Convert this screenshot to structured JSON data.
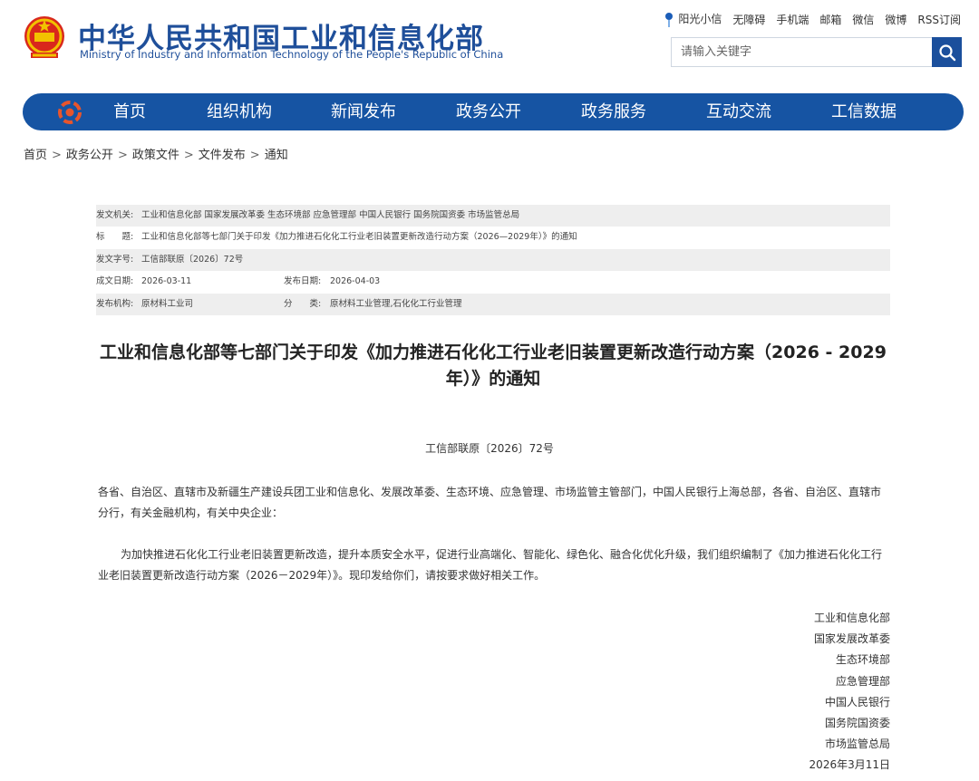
{
  "header": {
    "title": "中华人民共和国工业和信息化部",
    "subtitle": "Ministry of Industry and Information Technology of the People's Republic of China",
    "emblem_icon": "national-emblem-icon"
  },
  "toplinks": [
    "阳光小信",
    "无障碍",
    "手机端",
    "邮箱",
    "微信",
    "微博",
    "RSS订阅"
  ],
  "search": {
    "placeholder": "请输入关键字",
    "value": "",
    "icon": "search-icon"
  },
  "nav": {
    "logo_icon": "miit-logo-icon",
    "items": [
      "首页",
      "组织机构",
      "新闻发布",
      "政务公开",
      "政务服务",
      "互动交流",
      "工信数据"
    ]
  },
  "breadcrumb": [
    "首页",
    "政务公开",
    "政策文件",
    "文件发布",
    "通知"
  ],
  "meta": {
    "issuer_label": "发文机关:",
    "issuer": "工业和信息化部 国家发展改革委 生态环境部 应急管理部 中国人民银行 国务院国资委 市场监管总局",
    "title_label": "标　　题:",
    "title": "工业和信息化部等七部门关于印发《加力推进石化化工行业老旧装置更新改造行动方案（2026—2029年）》的通知",
    "docno_label": "发文字号:",
    "docno": "工信部联原〔2026〕72号",
    "created_label": "成文日期:",
    "created": "2026-03-11",
    "published_label": "发布日期:",
    "published": "2026-04-03",
    "org_label": "发布机构:",
    "org": "原材料工业司",
    "category_label": "分　　类:",
    "category": "原材料工业管理,石化化工行业管理"
  },
  "article": {
    "title": "工业和信息化部等七部门关于印发《加力推进石化化工行业老旧装置更新改造行动方案（2026 - 2029年）》的通知",
    "doc_number": "工信部联原〔2026〕72号",
    "recipients": "各省、自治区、直辖市及新疆生产建设兵团工业和信息化、发展改革委、生态环境、应急管理、市场监管主管部门，中国人民银行上海总部，各省、自治区、直辖市分行，有关金融机构，有关中央企业：",
    "body": "为加快推进石化化工行业老旧装置更新改造，提升本质安全水平，促进行业高端化、智能化、绿色化、融合化优化升级，我们组织编制了《加力推进石化化工行业老旧装置更新改造行动方案（2026－2029年）》。现印发给你们，请按要求做好相关工作。",
    "signatures": [
      "工业和信息化部",
      "国家发展改革委",
      "生态环境部",
      "应急管理部",
      "中国人民银行",
      "国务院国资委",
      "市场监管总局",
      "2026年3月11日"
    ]
  },
  "colors": {
    "brand_blue": "#1654a3",
    "title_blue": "#1f4f9a",
    "meta_shade": "#eeeeee"
  }
}
